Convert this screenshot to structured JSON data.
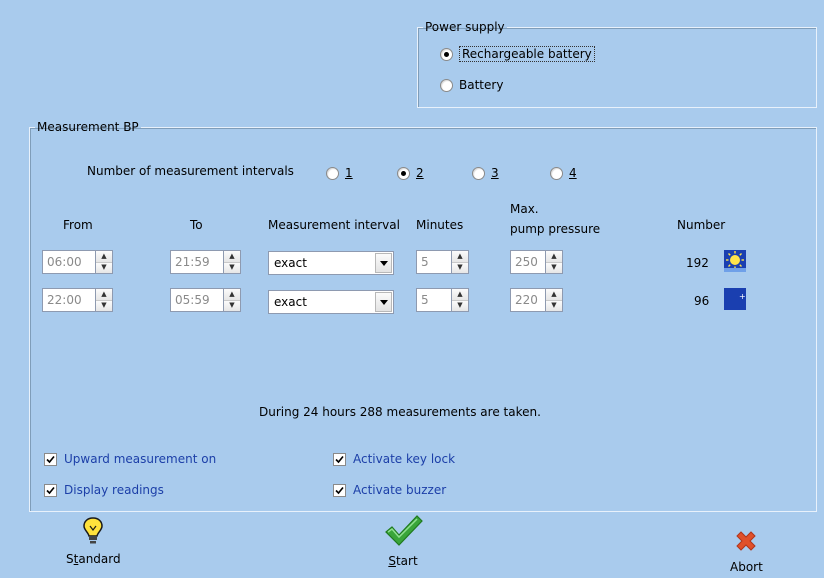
{
  "power_supply": {
    "legend": "Power supply",
    "options": [
      {
        "label": "Rechargeable battery",
        "checked": true
      },
      {
        "label": "Battery",
        "checked": false
      }
    ]
  },
  "measurement": {
    "legend": "Measurement BP",
    "intervals_label": "Number of measurement intervals",
    "interval_options": [
      {
        "label": "1",
        "checked": false
      },
      {
        "label": "2",
        "checked": true
      },
      {
        "label": "3",
        "checked": false
      },
      {
        "label": "4",
        "checked": false
      }
    ],
    "headers": {
      "from": "From",
      "to": "To",
      "interval": "Measurement interval",
      "minutes": "Minutes",
      "pressure_line1": "Max.",
      "pressure_line2": "pump pressure",
      "number": "Number"
    },
    "rows": [
      {
        "from": "06:00",
        "to": "21:59",
        "interval": "exact",
        "minutes": "5",
        "pressure": "250",
        "number": "192",
        "icon": "sun-icon"
      },
      {
        "from": "22:00",
        "to": "05:59",
        "interval": "exact",
        "minutes": "5",
        "pressure": "220",
        "number": "96",
        "icon": "moon-icon"
      }
    ],
    "summary": "During 24 hours 288 measurements are taken."
  },
  "options": {
    "upward": "Upward measurement on",
    "display": "Display readings",
    "keylock": "Activate key lock",
    "buzzer": "Activate buzzer"
  },
  "actions": {
    "standard": {
      "pre": "S",
      "u": "t",
      "post": "andard"
    },
    "start": {
      "pre": "",
      "u": "S",
      "post": "tart"
    },
    "abort": "Abort"
  },
  "colors": {
    "background": "#a9cbed",
    "option_text": "#1c3fa8"
  }
}
